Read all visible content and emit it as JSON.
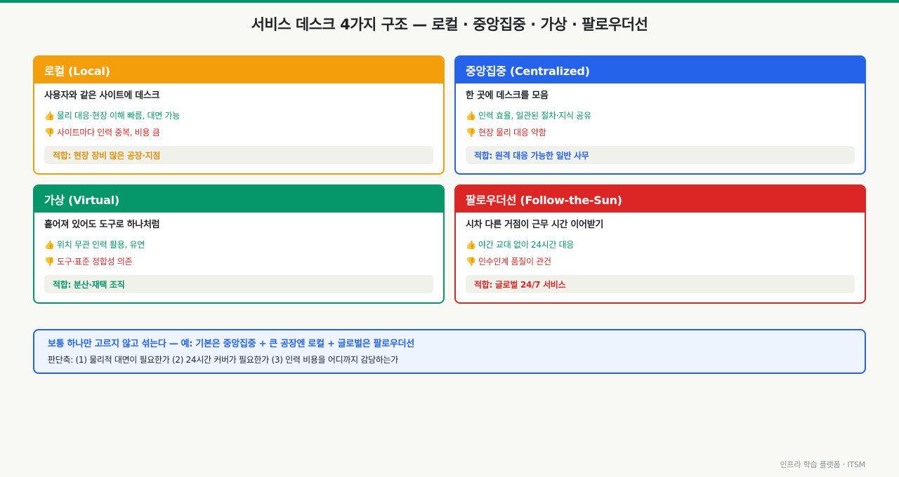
{
  "page": {
    "title": "서비스 데스크 4가지 구조 — 로컬 · 중앙집중 · 가상 · 팔로우더선",
    "footer": "인프라 학습 플랫폼 · ITSM"
  },
  "icons": {
    "pro": "thumbs-up-icon",
    "con": "thumbs-down-icon"
  },
  "colors": {
    "accent_top_bar": "#05966a",
    "local": "#f59e0b",
    "centralized": "#2563eb",
    "virtual": "#05966a",
    "follow_the_sun": "#dc2626"
  },
  "cards": {
    "local": {
      "title": "로컬 (Local)",
      "description": "사용자와 같은 사이트에 데스크",
      "pro": "물리 대응·현장 이해 빠름, 대면 가능",
      "con": "사이트마다 인력 중복, 비용 큼",
      "fit": "적합: 현장 장비 많은 공장·지점"
    },
    "centralized": {
      "title": "중앙집중 (Centralized)",
      "description": "한 곳에 데스크를 모음",
      "pro": "인력 효율, 일관된 절차·지식 공유",
      "con": "현장 물리 대응 약함",
      "fit": "적합: 원격 대응 가능한 일반 사무"
    },
    "virtual": {
      "title": "가상 (Virtual)",
      "description": "흩어져 있어도 도구로 하나처럼",
      "pro": "위치 무관 인력 활용, 유연",
      "con": "도구·표준 정합성 의존",
      "fit": "적합: 분산·재택 조직"
    },
    "follow_the_sun": {
      "title": "팔로우더선 (Follow-the-Sun)",
      "description": "시차 다른 거점이 근무 시간 이어받기",
      "pro": "야간 교대 없이 24시간 대응",
      "con": "인수인계 품질이 관건",
      "fit": "적합: 글로벌 24/7 서비스"
    }
  },
  "note": {
    "headline": "보통 하나만 고르지 않고 섞는다 — 예: 기본은 중앙집중 + 큰 공장엔 로컬 + 글로벌은 팔로우더선",
    "criteria": "판단축: (1) 물리적 대면이 필요한가 (2) 24시간 커버가 필요한가 (3) 인력 비용을 어디까지 감당하는가"
  }
}
